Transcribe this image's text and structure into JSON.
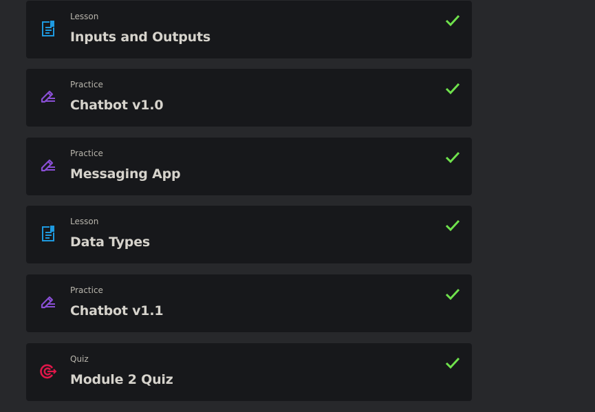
{
  "colors": {
    "page_bg": "#27282b",
    "card_bg": "#17181b",
    "lesson_icon": "#1e9ae0",
    "practice_icon": "#8a4fd6",
    "quiz_icon": "#e0174a",
    "check": "#6fe24c"
  },
  "items": [
    {
      "type": "Lesson",
      "title": "Inputs and Outputs",
      "icon": "lesson-document-icon",
      "completed": true
    },
    {
      "type": "Practice",
      "title": "Chatbot v1.0",
      "icon": "practice-pencil-icon",
      "completed": true
    },
    {
      "type": "Practice",
      "title": "Messaging App",
      "icon": "practice-pencil-icon",
      "completed": true
    },
    {
      "type": "Lesson",
      "title": "Data Types",
      "icon": "lesson-document-icon",
      "completed": true
    },
    {
      "type": "Practice",
      "title": "Chatbot v1.1",
      "icon": "practice-pencil-icon",
      "completed": true
    },
    {
      "type": "Quiz",
      "title": "Module 2 Quiz",
      "icon": "quiz-target-icon",
      "completed": true
    }
  ]
}
